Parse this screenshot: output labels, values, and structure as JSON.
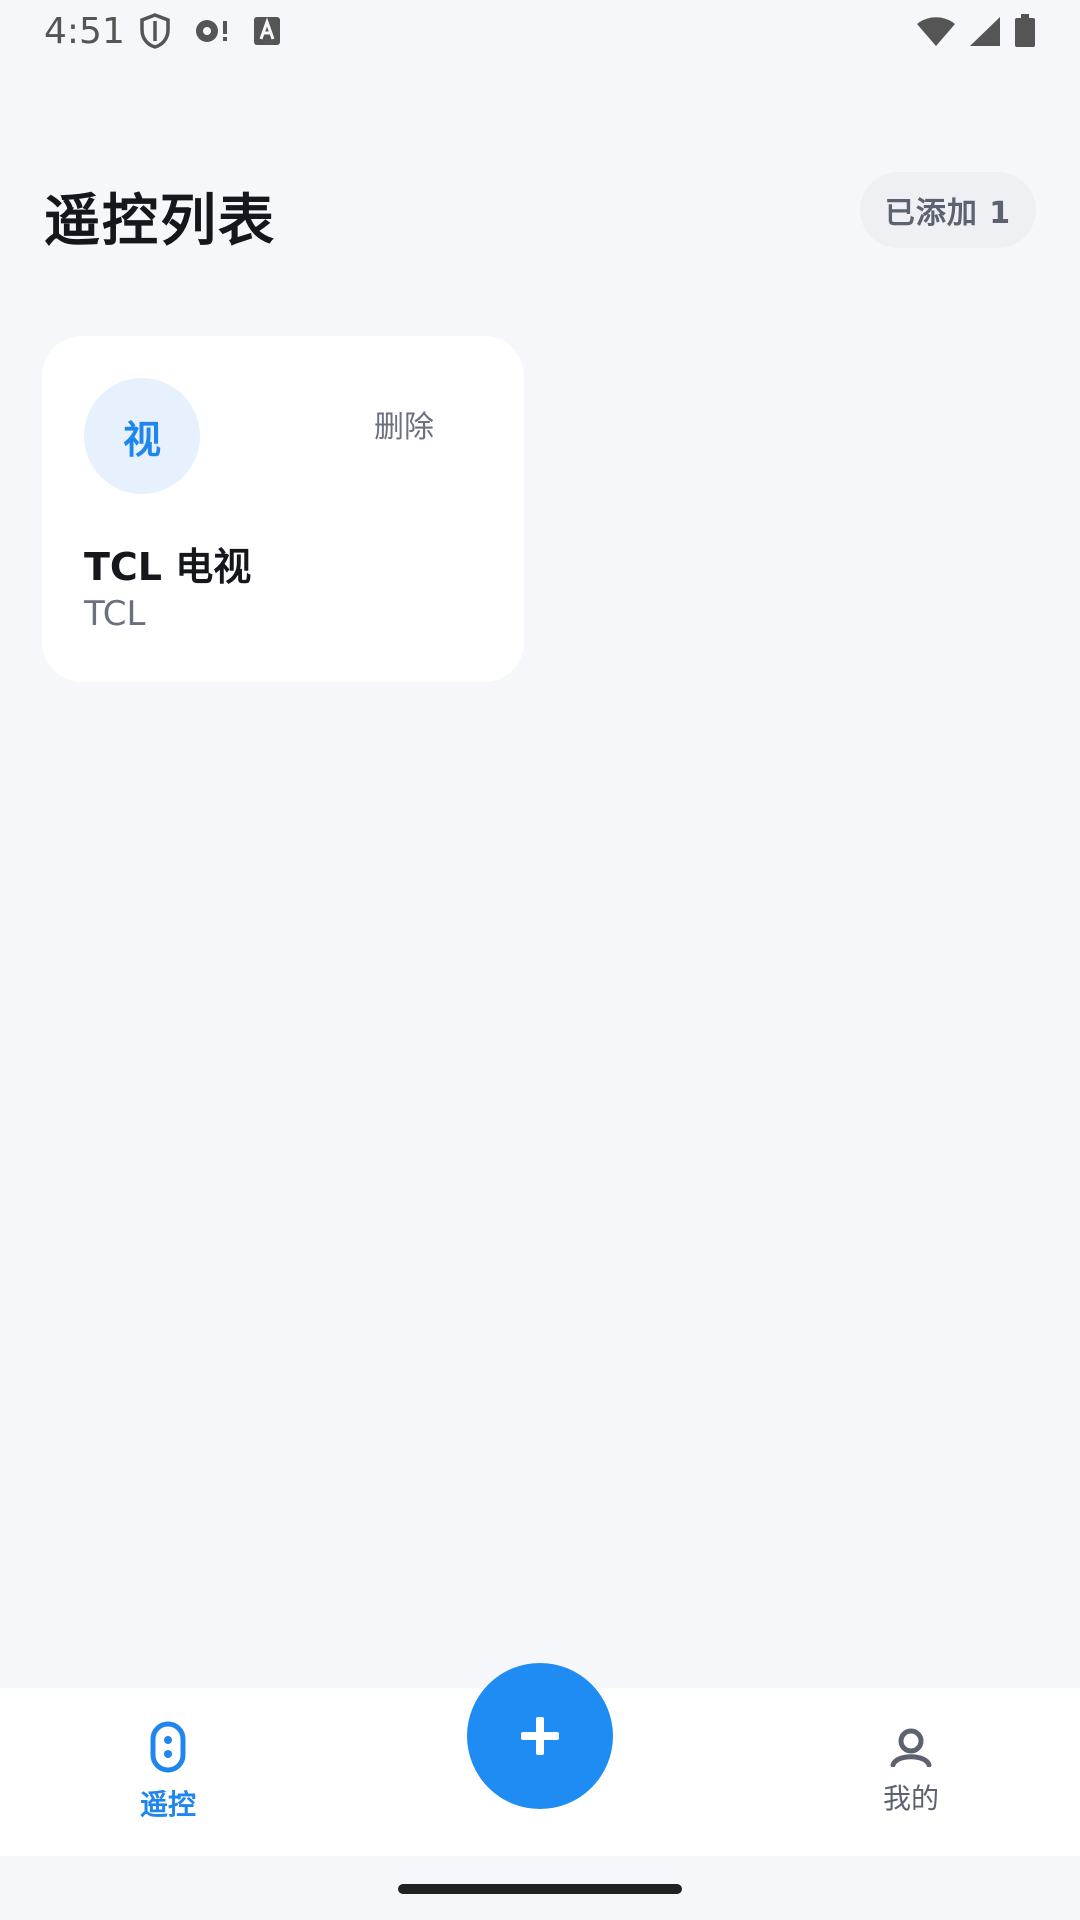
{
  "status_bar": {
    "time": "4:51",
    "left_icons": [
      "shield-icon",
      "sync-alert-icon",
      "text-a-icon"
    ],
    "right_icons": [
      "wifi-icon",
      "signal-icon",
      "battery-icon"
    ]
  },
  "header": {
    "title": "遥控列表",
    "count_badge": "已添加 1"
  },
  "devices": [
    {
      "avatar_char": "视",
      "delete_label": "删除",
      "name": "TCL 电视",
      "brand": "TCL"
    }
  ],
  "fab": {
    "icon": "plus-icon"
  },
  "bottom_nav": {
    "items": [
      {
        "label": "遥控",
        "icon": "remote-icon",
        "active": true
      },
      {
        "label": "我的",
        "icon": "person-icon",
        "active": false
      }
    ]
  },
  "colors": {
    "accent": "#1f8cf3",
    "background": "#f5f7fb",
    "card": "#ffffff",
    "text_primary": "#15171c",
    "text_secondary": "#6b7080"
  }
}
